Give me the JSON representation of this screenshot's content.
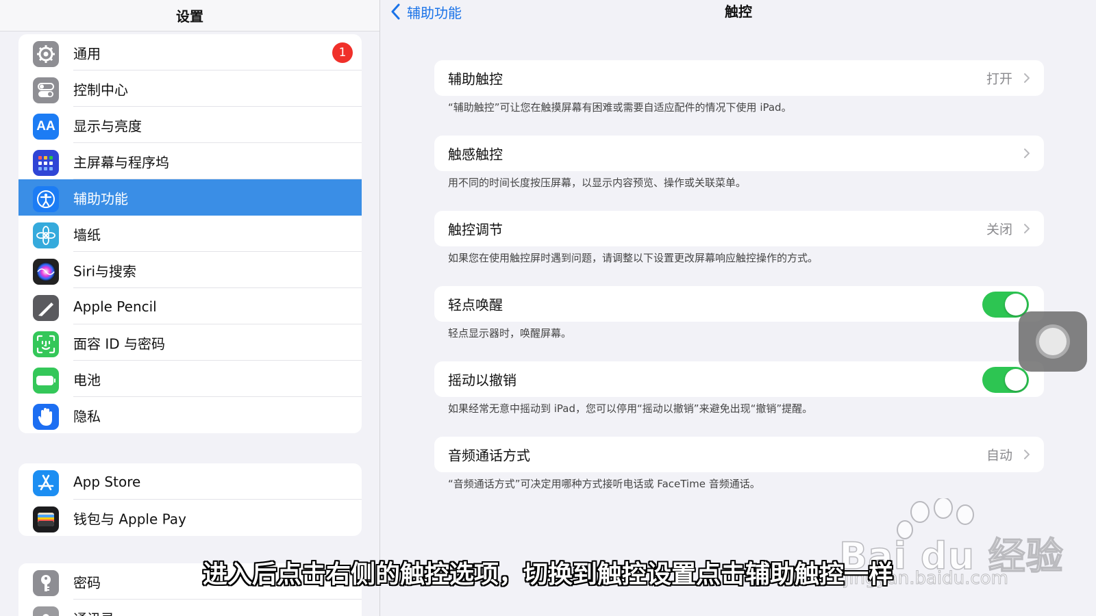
{
  "sidebar": {
    "title": "设置",
    "group1": [
      {
        "label": "通用",
        "icon": "gear-icon",
        "color": "#8e8e93",
        "badge": "1"
      },
      {
        "label": "控制中心",
        "icon": "control-center-icon",
        "color": "#8e8e93"
      },
      {
        "label": "显示与亮度",
        "icon": "display-brightness-icon",
        "color": "#1c7cf4"
      },
      {
        "label": "主屏幕与程序坞",
        "icon": "home-screen-icon",
        "color": "#2f45d6"
      },
      {
        "label": "辅助功能",
        "icon": "accessibility-icon",
        "color": "#1c7cf4",
        "selected": true
      },
      {
        "label": "墙纸",
        "icon": "wallpaper-icon",
        "color": "#35aadc"
      },
      {
        "label": "Siri与搜索",
        "icon": "siri-icon",
        "color": "#222222"
      },
      {
        "label": "Apple Pencil",
        "icon": "pencil-icon",
        "color": "#5a5a5e"
      },
      {
        "label": "面容 ID 与密码",
        "icon": "face-id-icon",
        "color": "#34c759"
      },
      {
        "label": "电池",
        "icon": "battery-icon",
        "color": "#34c759"
      },
      {
        "label": "隐私",
        "icon": "hand-icon",
        "color": "#1c6ef2"
      }
    ],
    "group2": [
      {
        "label": "App Store",
        "icon": "app-store-icon",
        "color": "#1c8ef2"
      },
      {
        "label": "钱包与 Apple Pay",
        "icon": "wallet-icon",
        "color": "#1c1c1e"
      }
    ],
    "group3": [
      {
        "label": "密码",
        "icon": "key-icon",
        "color": "#8e8e93"
      },
      {
        "label": "通讯录",
        "icon": "contacts-icon",
        "color": "#9a9a9e"
      }
    ]
  },
  "detail": {
    "back_label": "辅助功能",
    "title": "触控",
    "rows": [
      {
        "label": "辅助触控",
        "value": "打开",
        "type": "link",
        "desc": "“辅助触控”可让您在触摸屏幕有困难或需要自适应配件的情况下使用 iPad。"
      },
      {
        "label": "触感触控",
        "value": "",
        "type": "link",
        "desc": "用不同的时间长度按压屏幕，以显示内容预览、操作或关联菜单。"
      },
      {
        "label": "触控调节",
        "value": "关闭",
        "type": "link",
        "desc": "如果您在使用触控屏时遇到问题，请调整以下设置更改屏幕响应触控操作的方式。"
      },
      {
        "label": "轻点唤醒",
        "value": "",
        "type": "toggle",
        "on": true,
        "desc": "轻点显示器时，唤醒屏幕。"
      },
      {
        "label": "摇动以撤销",
        "value": "",
        "type": "toggle",
        "on": true,
        "desc": "如果经常无意中摇动到 iPad，您可以停用“摇动以撤销”来避免出现“撤销”提醒。"
      },
      {
        "label": "音频通话方式",
        "value": "自动",
        "type": "link",
        "desc": "“音频通话方式”可决定用哪种方式接听电话或 FaceTime 音频通话。"
      }
    ]
  },
  "overlay": {
    "subtitle": "进入后点击右侧的触控选项，切换到触控设置点击辅助触控一样",
    "watermark_text": "Bai du 经验",
    "watermark_url": "jingyan.baidu.com"
  },
  "colors": {
    "accent": "#1a73e8",
    "selected": "#3a8ee6",
    "toggle_on": "#2dc552",
    "badge": "#f0302a"
  }
}
